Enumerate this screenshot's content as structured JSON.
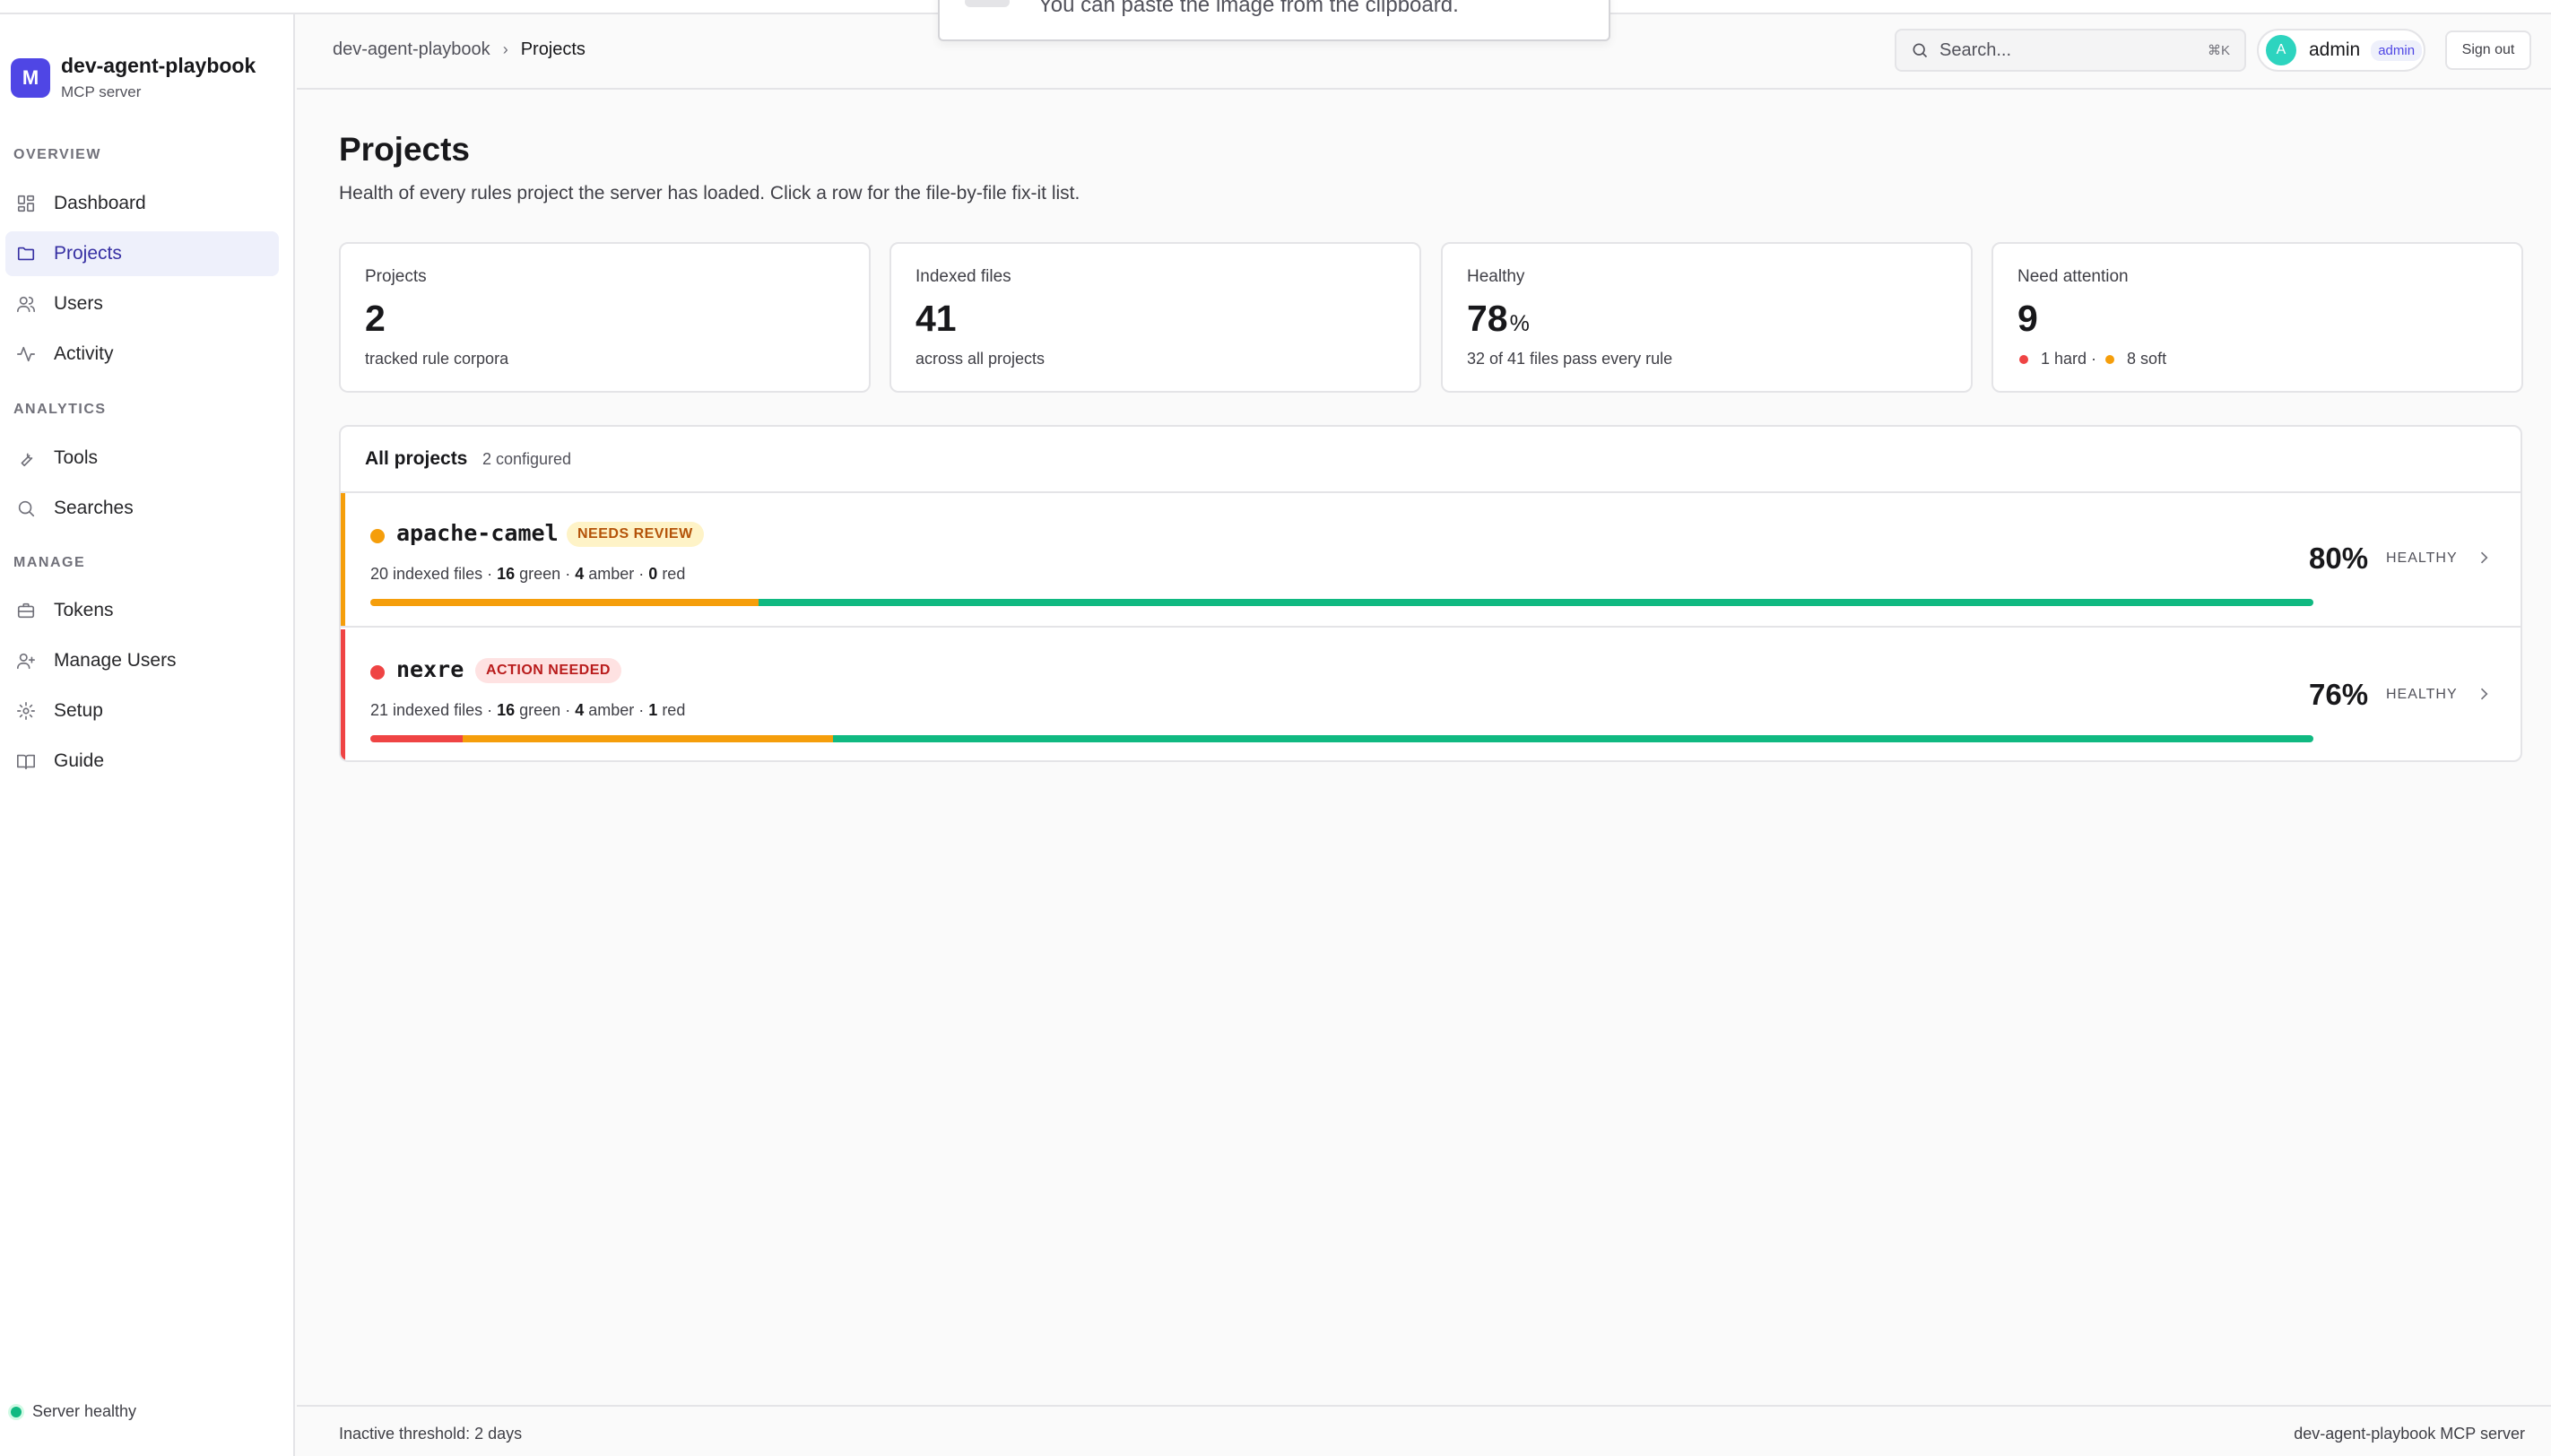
{
  "toast": {
    "text": "You can paste the image from the clipboard."
  },
  "brand": {
    "logo_letter": "M",
    "name": "dev-agent-playbook",
    "subtitle": "MCP server"
  },
  "sidebar": {
    "sections": [
      {
        "label": "OVERVIEW"
      },
      {
        "label": "ANALYTICS"
      },
      {
        "label": "MANAGE"
      }
    ],
    "items": [
      {
        "label": "Dashboard",
        "icon": "grid-icon"
      },
      {
        "label": "Projects",
        "icon": "folder-icon",
        "active": true
      },
      {
        "label": "Users",
        "icon": "users-icon"
      },
      {
        "label": "Activity",
        "icon": "activity-icon"
      },
      {
        "label": "Tools",
        "icon": "wrench-icon"
      },
      {
        "label": "Searches",
        "icon": "search-icon"
      },
      {
        "label": "Tokens",
        "icon": "briefcase-icon"
      },
      {
        "label": "Manage Users",
        "icon": "user-plus-icon"
      },
      {
        "label": "Setup",
        "icon": "gear-icon"
      },
      {
        "label": "Guide",
        "icon": "book-icon"
      }
    ],
    "status": "Server healthy"
  },
  "header": {
    "breadcrumb_root": "dev-agent-playbook",
    "breadcrumb_sep": "›",
    "breadcrumb_current": "Projects",
    "search_placeholder": "Search...",
    "search_shortcut": "⌘K",
    "user_initial": "A",
    "user_name": "admin",
    "user_role": "admin",
    "signout_label": "Sign out"
  },
  "page": {
    "title": "Projects",
    "subtitle": "Health of every rules project the server has loaded. Click a row for the file-by-file fix-it list."
  },
  "stats": [
    {
      "label": "Projects",
      "value": "2",
      "foot": "tracked rule corpora"
    },
    {
      "label": "Indexed files",
      "value": "41",
      "foot": "across all projects"
    },
    {
      "label": "Healthy",
      "value": "78",
      "unit": "%",
      "foot": "32 of 41 files pass every rule"
    },
    {
      "label": "Need attention",
      "value": "9",
      "hard": "1 hard ·",
      "soft": "8 soft"
    }
  ],
  "projects_panel": {
    "title": "All projects",
    "count": "2 configured",
    "rows": [
      {
        "name": "apache-camel",
        "badge": "NEEDS REVIEW",
        "files_text": "20 indexed files ·",
        "green": "16",
        "green_label": "green ·",
        "amber": "4",
        "amber_label": "amber ·",
        "red": "0",
        "red_label": "red",
        "percent": "80%",
        "percent_label": "HEALTHY",
        "status_color": "#f59e0b",
        "bar": {
          "red": 0,
          "amber": 4,
          "green": 16
        }
      },
      {
        "name": "nexre",
        "badge": "ACTION NEEDED",
        "files_text": "21 indexed files ·",
        "green": "16",
        "green_label": "green ·",
        "amber": "4",
        "amber_label": "amber ·",
        "red": "1",
        "red_label": "red",
        "percent": "76%",
        "percent_label": "HEALTHY",
        "status_color": "#ef4444",
        "bar": {
          "red": 1,
          "amber": 4,
          "green": 16
        }
      }
    ]
  },
  "footer": {
    "left": "Inactive threshold: 2 days",
    "right": "dev-agent-playbook MCP server"
  }
}
